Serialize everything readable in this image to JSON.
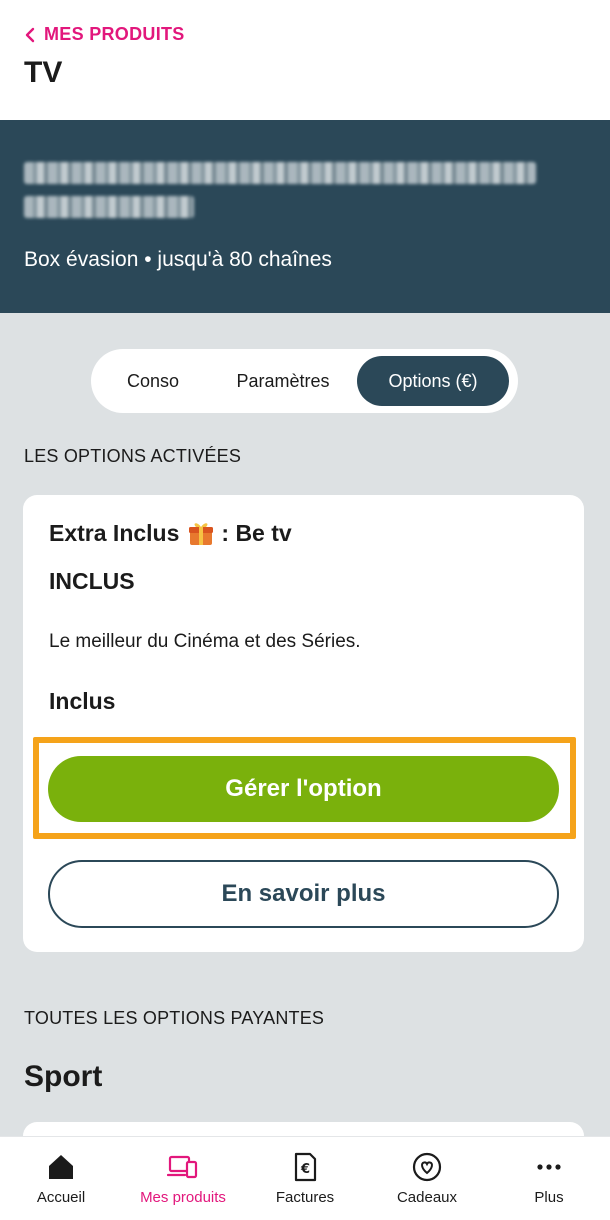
{
  "header": {
    "back_label": "MES PRODUITS",
    "title": "TV"
  },
  "banner": {
    "plan": "Box évasion • jusqu'à 80 chaînes"
  },
  "tabs": [
    {
      "label": "Conso",
      "active": false
    },
    {
      "label": "Paramètres",
      "active": false
    },
    {
      "label": "Options (€)",
      "active": true
    }
  ],
  "sections": {
    "activated": "LES OPTIONS ACTIVÉES",
    "paid": "TOUTES LES OPTIONS PAYANTES"
  },
  "option_card": {
    "title_prefix": "Extra Inclus",
    "title_suffix": ": Be tv",
    "gift_icon": "gift-icon",
    "status": "INCLUS",
    "description": "Le meilleur du Cinéma et des Séries.",
    "price": "Inclus",
    "manage_button": "Gérer l'option",
    "more_button": "En savoir plus"
  },
  "category": "Sport",
  "nav": [
    {
      "label": "Accueil",
      "icon": "home-icon",
      "active": false
    },
    {
      "label": "Mes produits",
      "icon": "devices-icon",
      "active": true
    },
    {
      "label": "Factures",
      "icon": "invoice-euro-icon",
      "active": false
    },
    {
      "label": "Cadeaux",
      "icon": "heart-badge-icon",
      "active": false
    },
    {
      "label": "Plus",
      "icon": "more-dots-icon",
      "active": false
    }
  ],
  "colors": {
    "brand_pink": "#e2177c",
    "banner_dark": "#2b4858",
    "primary_green": "#7ab10c",
    "highlight_orange": "#f5a31a",
    "background": "#dde1e3"
  }
}
